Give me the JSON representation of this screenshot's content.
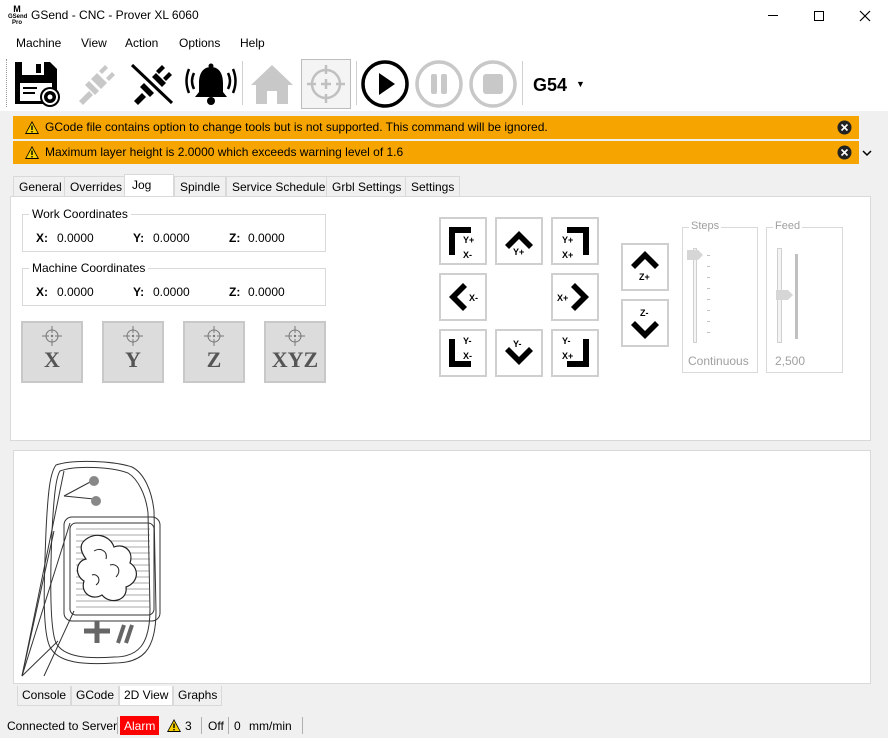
{
  "window": {
    "title": "GSend - CNC - Prover XL 6060",
    "app_icon_text": "M GSend Pro"
  },
  "menu": {
    "items": [
      "Machine",
      "View",
      "Action",
      "Options",
      "Help"
    ]
  },
  "toolbar": {
    "buttons": [
      {
        "name": "save-settings",
        "icon": "floppy-gear-icon",
        "enabled": true
      },
      {
        "name": "connect",
        "icon": "plug-connect-icon",
        "enabled": false
      },
      {
        "name": "disconnect",
        "icon": "plug-disconnect-icon",
        "enabled": true
      },
      {
        "name": "alarm",
        "icon": "bell-icon",
        "enabled": true
      },
      {
        "name": "home",
        "icon": "house-icon",
        "enabled": false
      },
      {
        "name": "probe",
        "icon": "crosshair-icon",
        "enabled": false
      },
      {
        "name": "run",
        "icon": "play-icon",
        "enabled": true
      },
      {
        "name": "pause",
        "icon": "pause-icon",
        "enabled": false
      },
      {
        "name": "stop",
        "icon": "stop-icon",
        "enabled": false
      }
    ],
    "coordinate_system": "G54"
  },
  "warnings": [
    {
      "text": "GCode file contains option to change tools but is not supported.  This command will be ignored.",
      "color": "#f6a500"
    },
    {
      "text": "Maximum layer height is 2.0000 which exceeds warning level of 1.6",
      "color": "#f6a500"
    }
  ],
  "tabs": {
    "items": [
      "General",
      "Overrides",
      "Jog",
      "Spindle",
      "Service Schedule",
      "Grbl Settings",
      "Settings"
    ],
    "active": "Jog"
  },
  "jog": {
    "work_coordinates": {
      "title": "Work Coordinates",
      "x_label": "X:",
      "x": "0.0000",
      "y_label": "Y:",
      "y": "0.0000",
      "z_label": "Z:",
      "z": "0.0000"
    },
    "machine_coordinates": {
      "title": "Machine Coordinates",
      "x_label": "X:",
      "x": "0.0000",
      "y_label": "Y:",
      "y": "0.0000",
      "z_label": "Z:",
      "z": "0.0000"
    },
    "zero_buttons": [
      "X",
      "Y",
      "Z",
      "XYZ"
    ],
    "pad": {
      "y_plus_x_minus": [
        "Y+",
        "X-"
      ],
      "y_plus": "Y+",
      "y_plus_x_plus": [
        "Y+",
        "X+"
      ],
      "x_minus": "X-",
      "x_plus": "X+",
      "y_minus_x_minus": [
        "Y-",
        "X-"
      ],
      "y_minus": "Y-",
      "y_minus_x_plus": [
        "Y-",
        "X+"
      ],
      "z_plus": "Z+",
      "z_minus": "Z-"
    },
    "steps": {
      "title": "Steps",
      "value": "Continuous"
    },
    "feed": {
      "title": "Feed",
      "value": "2,500"
    }
  },
  "bottom_tabs": {
    "items": [
      "Console",
      "GCode",
      "2D View",
      "Graphs"
    ],
    "active": "2D View"
  },
  "status": {
    "connection": "Connected to Server",
    "state": "Alarm",
    "state_color": "#ff0000",
    "warning_count": "3",
    "spindle": "Off",
    "feed_value": "0",
    "feed_unit": "mm/min"
  }
}
